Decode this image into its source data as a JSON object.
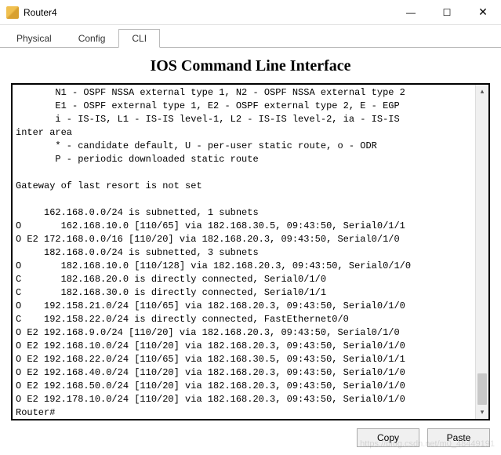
{
  "window": {
    "title": "Router4"
  },
  "tabs": {
    "physical": "Physical",
    "config": "Config",
    "cli": "CLI"
  },
  "heading": "IOS Command Line Interface",
  "terminal": {
    "lines": [
      "       N1 - OSPF NSSA external type 1, N2 - OSPF NSSA external type 2",
      "       E1 - OSPF external type 1, E2 - OSPF external type 2, E - EGP",
      "       i - IS-IS, L1 - IS-IS level-1, L2 - IS-IS level-2, ia - IS-IS",
      "inter area",
      "       * - candidate default, U - per-user static route, o - ODR",
      "       P - periodic downloaded static route",
      "",
      "Gateway of last resort is not set",
      "",
      "     162.168.0.0/24 is subnetted, 1 subnets",
      "O       162.168.10.0 [110/65] via 182.168.30.5, 09:43:50, Serial0/1/1",
      "O E2 172.168.0.0/16 [110/20] via 182.168.20.3, 09:43:50, Serial0/1/0",
      "     182.168.0.0/24 is subnetted, 3 subnets",
      "O       182.168.10.0 [110/128] via 182.168.20.3, 09:43:50, Serial0/1/0",
      "C       182.168.20.0 is directly connected, Serial0/1/0",
      "C       182.168.30.0 is directly connected, Serial0/1/1",
      "O    192.158.21.0/24 [110/65] via 182.168.20.3, 09:43:50, Serial0/1/0",
      "C    192.158.22.0/24 is directly connected, FastEthernet0/0",
      "O E2 192.168.9.0/24 [110/20] via 182.168.20.3, 09:43:50, Serial0/1/0",
      "O E2 192.168.10.0/24 [110/20] via 182.168.20.3, 09:43:50, Serial0/1/0",
      "O E2 192.168.22.0/24 [110/65] via 182.168.30.5, 09:43:50, Serial0/1/1",
      "O E2 192.168.40.0/24 [110/20] via 182.168.20.3, 09:43:50, Serial0/1/0",
      "O E2 192.168.50.0/24 [110/20] via 182.168.20.3, 09:43:50, Serial0/1/0",
      "O E2 192.178.10.0/24 [110/20] via 182.168.20.3, 09:43:50, Serial0/1/0",
      "Router#"
    ]
  },
  "buttons": {
    "copy": "Copy",
    "paste": "Paste"
  },
  "watermark": "https://blog.csdn.net/m0_48449191"
}
